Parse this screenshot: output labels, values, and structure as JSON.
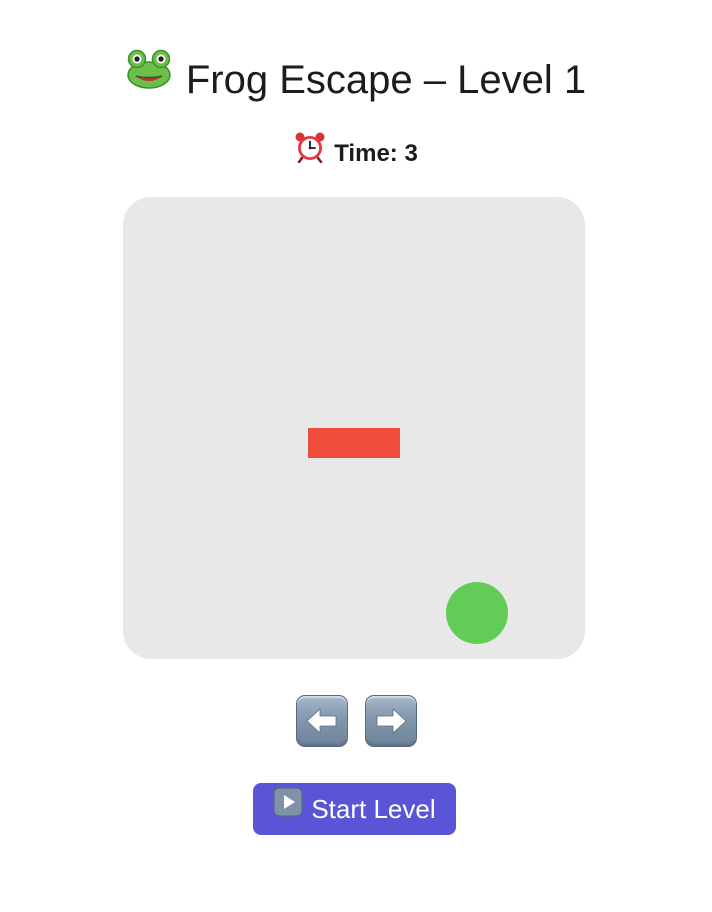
{
  "header": {
    "icon": "frog-face-icon",
    "title": "Frog Escape – Level 1"
  },
  "timer": {
    "icon": "alarm-clock-icon",
    "label": "Time: 3"
  },
  "board": {
    "background": "#e8e8e8",
    "obstacle_color": "#ef4d3c",
    "frog_color": "#62cc57"
  },
  "controls": {
    "left_icon": "left-arrow-icon",
    "right_icon": "right-arrow-icon"
  },
  "start_button": {
    "icon": "play-icon",
    "label": "Start Level",
    "color": "#5a55d6"
  }
}
